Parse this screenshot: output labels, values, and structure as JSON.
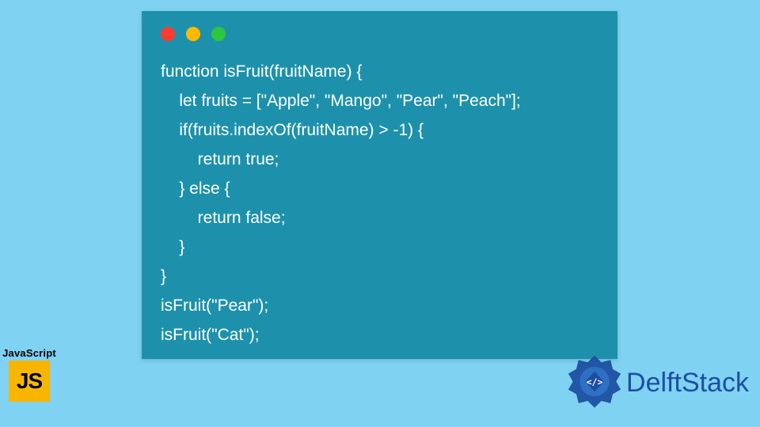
{
  "code_window": {
    "traffic_lights": [
      "red",
      "amber",
      "green"
    ],
    "background": "#1d91ac",
    "lines": [
      "function isFruit(fruitName) {",
      "    let fruits = [\"Apple\", \"Mango\", \"Pear\", \"Peach\"];",
      "    if(fruits.indexOf(fruitName) > -1) {",
      "        return true;",
      "    } else {",
      "        return false;",
      "    }",
      "}",
      "isFruit(\"Pear\");",
      "isFruit(\"Cat\");"
    ]
  },
  "js_badge": {
    "label": "JavaScript",
    "glyph": "JS"
  },
  "brand": {
    "name": "DelftStack",
    "logo_color": "#1c4fa1"
  }
}
